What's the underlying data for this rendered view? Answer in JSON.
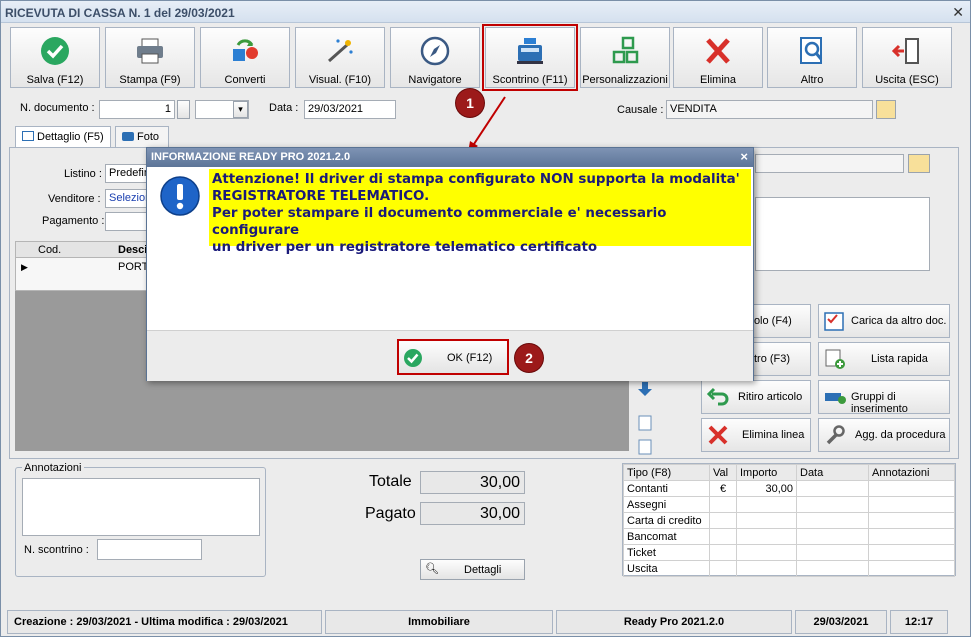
{
  "window": {
    "title": "RICEVUTA DI CASSA N. 1 del 29/03/2021",
    "close": "✕"
  },
  "toolbar": [
    {
      "label": "Salva (F12)",
      "icon": "check-circle-icon"
    },
    {
      "label": "Stampa (F9)",
      "icon": "printer-icon"
    },
    {
      "label": "Converti",
      "icon": "convert-icon"
    },
    {
      "label": "Visual. (F10)",
      "icon": "magic-wand-icon"
    },
    {
      "label": "Navigatore",
      "icon": "compass-icon"
    },
    {
      "label": "Scontrino (F11)",
      "icon": "cash-register-icon"
    },
    {
      "label": "Personalizzazioni",
      "icon": "grid-icon"
    },
    {
      "label": "Elimina",
      "icon": "delete-x-icon"
    },
    {
      "label": "Altro",
      "icon": "search-document-icon"
    },
    {
      "label": "Uscita (ESC)",
      "icon": "exit-icon"
    }
  ],
  "header": {
    "doc_number_label": "N. documento :",
    "doc_number": "1",
    "data_label": "Data :",
    "data_value": "29/03/2021",
    "causale_label": "Causale :",
    "causale_value": "VENDITA"
  },
  "tabs": [
    {
      "label": "Dettaglio (F5)"
    },
    {
      "label": "Foto"
    }
  ],
  "form": {
    "listino_label": "Listino :",
    "listino_value": "Predefin",
    "venditore_label": "Venditore :",
    "venditore_value": "Selezion",
    "pagamento_label": "Pagamento :"
  },
  "grid": {
    "col_cod": "Cod.",
    "col_desc": "Desci",
    "row1_desc": "PORTA"
  },
  "right_buttons": [
    {
      "label": "icolo (F4)"
    },
    {
      "label": "Carica da altro doc."
    },
    {
      "label": "tro (F3)"
    },
    {
      "label": "Lista rapida"
    },
    {
      "label": "Ritiro articolo"
    },
    {
      "label": "Gruppi di inserimento"
    },
    {
      "label": "Elimina linea"
    },
    {
      "label": "Agg. da procedura"
    }
  ],
  "annotazioni": {
    "label": "Annotazioni",
    "scontrino_label": "N. scontrino :"
  },
  "totals": {
    "totale_label": "Totale",
    "totale_value": "30,00",
    "pagato_label": "Pagato",
    "pagato_value": "30,00",
    "dettagli_label": "Dettagli"
  },
  "payments": {
    "headers": [
      "Tipo (F8)",
      "Val",
      "Importo",
      "Data",
      "Annotazioni"
    ],
    "rows": [
      {
        "tipo": "Contanti",
        "val": "€",
        "importo": "30,00"
      },
      {
        "tipo": "Assegni",
        "val": "",
        "importo": ""
      },
      {
        "tipo": "Carta di credito",
        "val": "",
        "importo": ""
      },
      {
        "tipo": "Bancomat",
        "val": "",
        "importo": ""
      },
      {
        "tipo": "Ticket",
        "val": "",
        "importo": ""
      },
      {
        "tipo": "Uscita",
        "val": "",
        "importo": ""
      }
    ]
  },
  "status": {
    "created": "Creazione : 29/03/2021 - Ultima modifica : 29/03/2021",
    "company": "Immobiliare",
    "app": "Ready Pro 2021.2.0",
    "date": "29/03/2021",
    "time": "12:17"
  },
  "dialog": {
    "title": "INFORMAZIONE READY PRO 2021.2.0",
    "close": "×",
    "message_lines": [
      "Attenzione! Il driver di stampa configurato NON supporta la modalita'",
      "REGISTRATORE TELEMATICO.",
      "Per poter stampare il documento commerciale e' necessario configurare",
      "un driver per un registratore telematico certificato"
    ],
    "ok_label": "OK (F12)"
  },
  "annotations": {
    "badge1": "1",
    "badge2": "2"
  },
  "colors": {
    "highlight": "#c00000",
    "dialog_title": "#5d7598",
    "message_bg": "#ffff00",
    "badge": "#9c1a1a"
  }
}
